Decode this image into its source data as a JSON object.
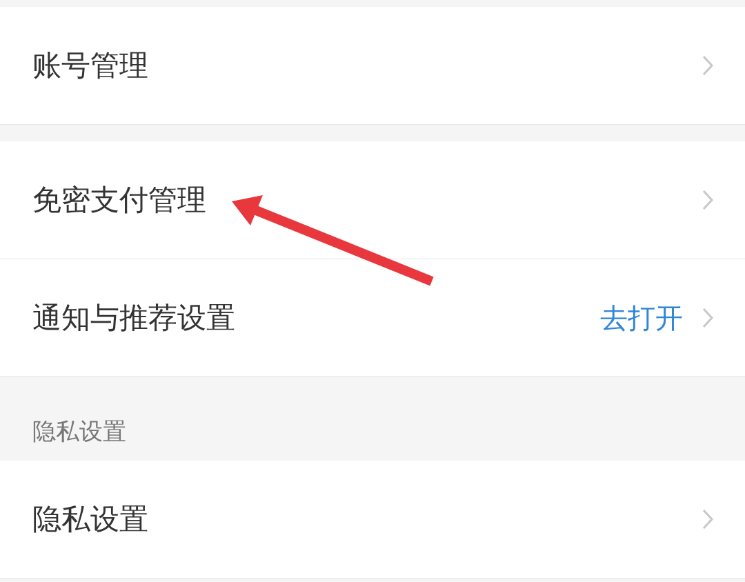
{
  "sections": [
    {
      "kind": "group",
      "rows": [
        {
          "label": "账号管理"
        }
      ]
    },
    {
      "kind": "group",
      "rows": [
        {
          "label": "免密支付管理"
        },
        {
          "label": "通知与推荐设置",
          "action": "去打开"
        }
      ]
    },
    {
      "kind": "header",
      "label": "隐私设置"
    },
    {
      "kind": "group",
      "rows": [
        {
          "label": "隐私设置"
        }
      ]
    }
  ]
}
